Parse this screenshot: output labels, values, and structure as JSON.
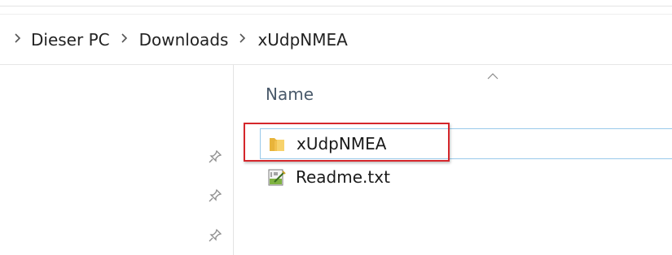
{
  "breadcrumb": {
    "items": [
      "Dieser PC",
      "Downloads",
      "xUdpNMEA"
    ]
  },
  "file_list": {
    "column_name": "Name",
    "sort_indicator_icon": "chevron-up-icon",
    "rows": [
      {
        "name": "xUdpNMEA",
        "icon": "folder-icon",
        "selected": true
      },
      {
        "name": "Readme.txt",
        "icon": "text-file-icon",
        "selected": false
      }
    ]
  },
  "nav_pane": {
    "pin_icons": [
      "pin-icon",
      "pin-icon",
      "pin-icon"
    ]
  },
  "colors": {
    "highlight_border": "#d5262b",
    "hover_border": "#99c9ea",
    "folder_yellow": "#f4c542",
    "header_text": "#4a5a6b"
  }
}
